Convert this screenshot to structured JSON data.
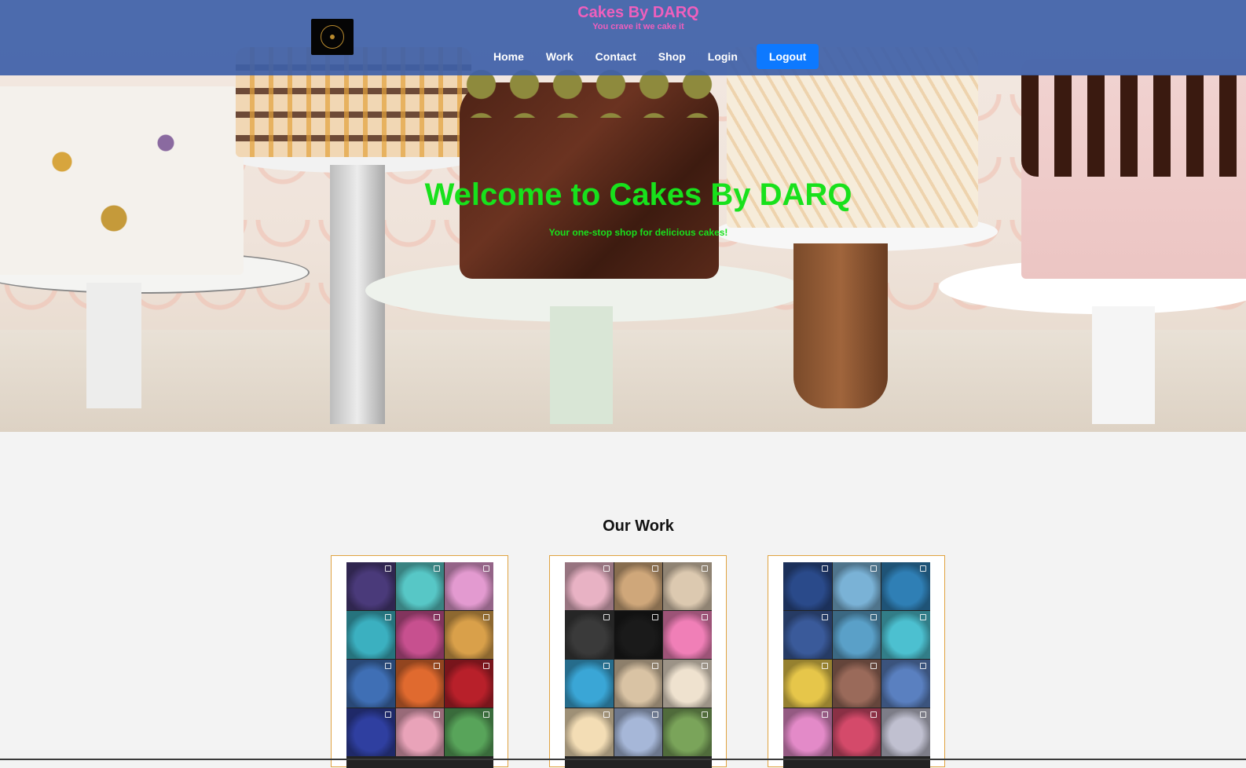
{
  "header": {
    "brand_title": "Cakes By DARQ",
    "brand_tagline": "You crave it we cake it",
    "nav": {
      "home": "Home",
      "work": "Work",
      "contact": "Contact",
      "shop": "Shop",
      "login": "Login",
      "logout": "Logout"
    }
  },
  "hero": {
    "title": "Welcome to Cakes By DARQ",
    "subtitle": "Your one-stop shop for delicious cakes!"
  },
  "work": {
    "title": "Our Work",
    "galleries": [
      {
        "tiles": [
          "#4a3a7a",
          "#57c7c6",
          "#e39ad0",
          "#3bb0c0",
          "#c7508f",
          "#d9a04a",
          "#3f6fb5",
          "#e06a2f",
          "#b8202a",
          "#2f3fa0",
          "#e9a3b9",
          "#58a45a"
        ]
      },
      {
        "tiles": [
          "#e8b2c4",
          "#cfa77a",
          "#dcc9b0",
          "#3a3a3a",
          "#1a1a1a",
          "#f07fb7",
          "#3aa6d6",
          "#d9c3a4",
          "#efe2cf",
          "#f3ddb5",
          "#a6b7d8",
          "#7aa45a"
        ]
      },
      {
        "tiles": [
          "#2a4a8a",
          "#7ab2d6",
          "#2f7fb5",
          "#3a5a9a",
          "#5aa0c8",
          "#4cc0d0",
          "#e6c64a",
          "#9a6a5a",
          "#5a80c0",
          "#e38ac8",
          "#d44a6a",
          "#c0c0d0"
        ]
      }
    ]
  },
  "colors": {
    "nav_bg": "#3e60a8",
    "brand": "#ef5fbd",
    "hero_text": "#18e11c",
    "logout_bg": "#0d79ff",
    "card_border": "#e0a341"
  }
}
